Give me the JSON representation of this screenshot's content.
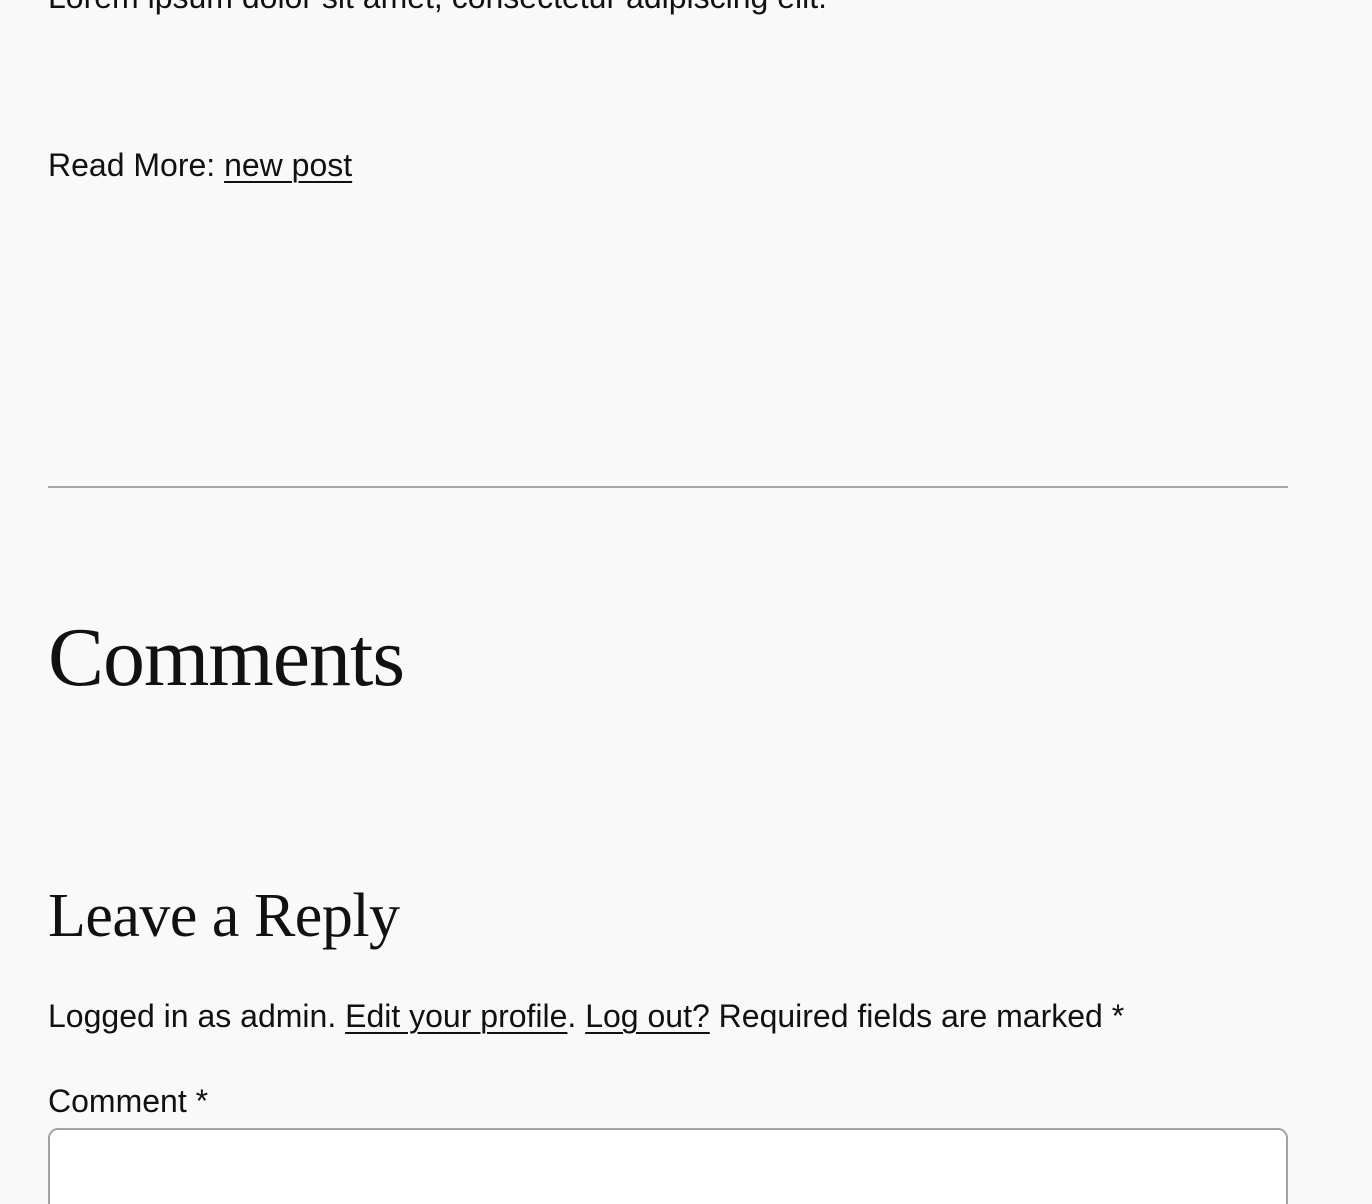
{
  "post": {
    "cut_line_text": "Lorem ipsum dolor sit amet, consectetur adipiscing elit.",
    "read_more_prefix": "Read More: ",
    "read_more_link": "new post"
  },
  "comments": {
    "title": "Comments"
  },
  "reply": {
    "title": "Leave a Reply",
    "logged_in_prefix": "Logged in as admin. ",
    "edit_profile_link": "Edit your profile",
    "period": ".",
    "logout_link": "Log out?",
    "required_text": " Required fields are marked ",
    "required_marker": "*",
    "comment_label": "Comment",
    "comment_required_marker": "*",
    "comment_value": ""
  }
}
